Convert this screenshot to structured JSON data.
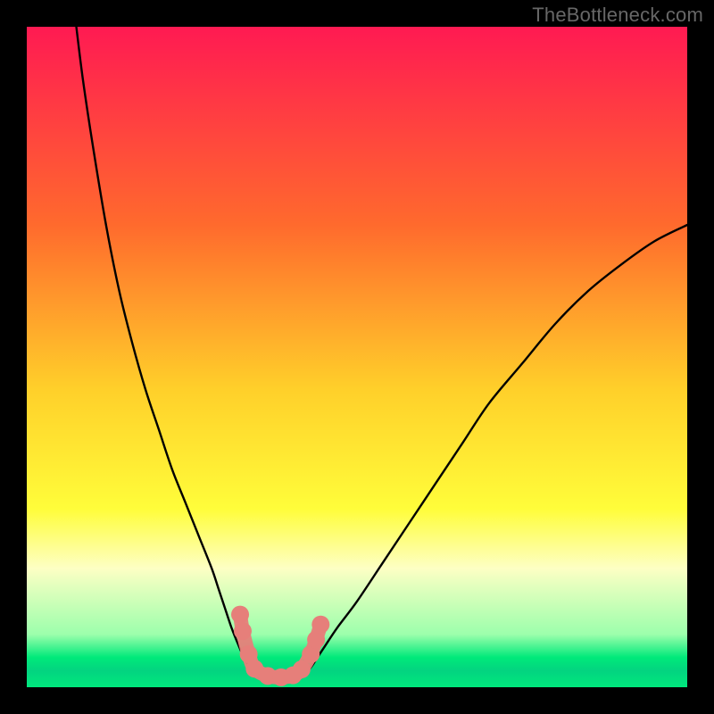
{
  "watermark": "TheBottleneck.com",
  "chart_data": {
    "type": "line",
    "title": "",
    "xlabel": "",
    "ylabel": "",
    "xlim": [
      0,
      100
    ],
    "ylim": [
      0,
      100
    ],
    "grid": false,
    "legend": false,
    "gradient_stops": [
      {
        "offset": 0,
        "color": "#ff1a52"
      },
      {
        "offset": 0.3,
        "color": "#ff6a2d"
      },
      {
        "offset": 0.55,
        "color": "#ffd02a"
      },
      {
        "offset": 0.73,
        "color": "#fffd3a"
      },
      {
        "offset": 0.82,
        "color": "#fdffc4"
      },
      {
        "offset": 0.92,
        "color": "#9cffac"
      },
      {
        "offset": 0.955,
        "color": "#00e97a"
      },
      {
        "offset": 0.975,
        "color": "#03d480"
      },
      {
        "offset": 1.0,
        "color": "#00e87d"
      }
    ],
    "series": [
      {
        "name": "left-branch",
        "color": "#000000",
        "x": [
          7.5,
          8.5,
          10,
          12,
          14,
          16,
          18,
          20,
          22,
          24,
          26,
          28,
          29,
          30,
          31,
          32,
          33,
          34,
          35
        ],
        "y": [
          100,
          92,
          82,
          70,
          60,
          52,
          45,
          39,
          33,
          28,
          23,
          18,
          15,
          12,
          9,
          6.5,
          4.3,
          2.8,
          2.1
        ]
      },
      {
        "name": "right-branch",
        "color": "#000000",
        "x": [
          42,
          43,
          44,
          45,
          47,
          50,
          54,
          58,
          62,
          66,
          70,
          75,
          80,
          85,
          90,
          95,
          100
        ],
        "y": [
          2.1,
          3.0,
          4.5,
          6,
          9,
          13,
          19,
          25,
          31,
          37,
          43,
          49,
          55,
          60,
          64,
          67.5,
          70
        ]
      },
      {
        "name": "valley-floor",
        "color": "#000000",
        "x": [
          35,
          36,
          37.5,
          39,
          40.5,
          42
        ],
        "y": [
          2.1,
          1.5,
          1.3,
          1.3,
          1.5,
          2.1
        ]
      }
    ],
    "markers": {
      "name": "highlighted-points",
      "color": "#e67f7a",
      "points": [
        {
          "x": 32.3,
          "y": 11.0
        },
        {
          "x": 32.7,
          "y": 8.5
        },
        {
          "x": 33.6,
          "y": 5.0
        },
        {
          "x": 34.5,
          "y": 2.8
        },
        {
          "x": 36.5,
          "y": 1.7
        },
        {
          "x": 38.5,
          "y": 1.5
        },
        {
          "x": 40.3,
          "y": 1.8
        },
        {
          "x": 41.6,
          "y": 2.7
        },
        {
          "x": 43.0,
          "y": 5.0
        },
        {
          "x": 43.8,
          "y": 7.2
        },
        {
          "x": 44.5,
          "y": 9.5
        }
      ]
    }
  }
}
